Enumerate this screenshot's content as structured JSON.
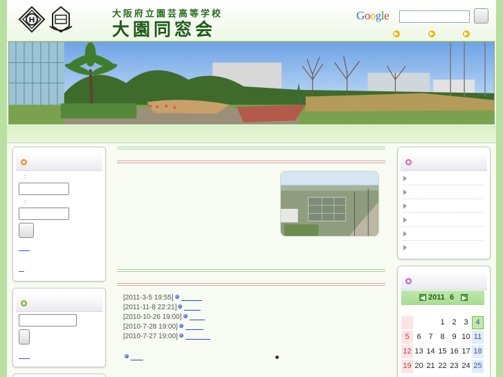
{
  "header": {
    "school_name": "大阪府立園芸高等学校",
    "site_title": "大園同窓会",
    "search_logo": "Google",
    "search_placeholder": "",
    "nav_icon": "arrow-right-circle-icon"
  },
  "login_box": {
    "icon": "flower-icon",
    "colon1": ":",
    "colon2": ":",
    "field_user_value": "",
    "field_pass_value": ""
  },
  "search_box": {
    "icon": "flower-icon",
    "field_value": ""
  },
  "news": [
    {
      "date": "[2011-3-5 19:55]"
    },
    {
      "date": "[2011-11-8 22:21]"
    },
    {
      "date": "[2010-10-26 19:00]"
    },
    {
      "date": "[2010-7-28 19:00]"
    },
    {
      "date": "[2010-7-27 19:00]"
    }
  ],
  "menu_box": {
    "icon": "flower-icon",
    "items_count_visible": 6
  },
  "calendar": {
    "year": "2011",
    "month": "6",
    "prev_icon": "prev-month-icon",
    "next_icon": "next-month-icon",
    "rows": [
      [
        "",
        "",
        "",
        "1",
        "2",
        "3",
        "4"
      ],
      [
        "5",
        "6",
        "7",
        "8",
        "9",
        "10",
        "11"
      ],
      [
        "12",
        "13",
        "14",
        "15",
        "16",
        "17",
        "18"
      ],
      [
        "19",
        "20",
        "21",
        "22",
        "23",
        "24",
        "25"
      ]
    ],
    "today": "4"
  },
  "colors": {
    "frame": "#b8e0a0",
    "title_green": "#1d5a18",
    "calendar_head": "#a8dc92"
  }
}
